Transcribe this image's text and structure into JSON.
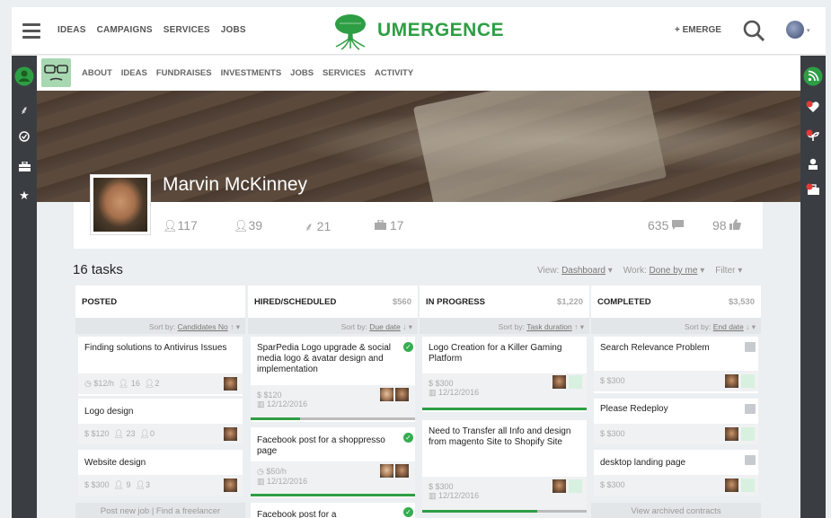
{
  "topnav": {
    "items": [
      "IDEAS",
      "CAMPAIGNS",
      "SERVICES",
      "JOBS"
    ],
    "brand": "UMERGENCE",
    "emerge_label": "+ EMERGE"
  },
  "profile_nav": {
    "items": [
      "ABOUT",
      "IDEAS",
      "FUNDRAISES",
      "INVESTMENTS",
      "JOBS",
      "SERVICES",
      "ACTIVITY"
    ]
  },
  "profile": {
    "name": "Marvin McKinney",
    "stats": {
      "a": "117",
      "b": "39",
      "c": "21",
      "d": "17",
      "comments": "635",
      "likes": "98"
    }
  },
  "tasks": {
    "title": "16 tasks",
    "view_label": "View:",
    "view_value": "Dashboard",
    "work_label": "Work:",
    "work_value": "Done by me",
    "filter_label": "Filter"
  },
  "columns": [
    {
      "title": "POSTED",
      "amount": "",
      "sort_label": "Sort by:",
      "sort_value": "Candidates No",
      "cards": [
        {
          "title": "Finding solutions to Antivirus Issues",
          "meta": "$12/h",
          "m2": "16",
          "m3": "2"
        },
        {
          "title": "Logo design",
          "meta": "$120",
          "m2": "23",
          "m3": "0"
        },
        {
          "title": "Website design",
          "meta": "$300",
          "m2": "9",
          "m3": "3"
        }
      ],
      "footer": "Post new job | Find a freelancer"
    },
    {
      "title": "HIRED/SCHEDULED",
      "amount": "$560",
      "sort_label": "Sort by:",
      "sort_value": "Due date",
      "cards": [
        {
          "title": "SparPedia Logo upgrade & social media logo & avatar design and implementation",
          "meta": "$120",
          "date": "12/12/2016",
          "progress": 0.3
        },
        {
          "title": "Facebook post for a shoppresso page",
          "meta": "$50/h",
          "date": "12/12/2016",
          "progress": 1.0
        },
        {
          "title": "Facebook post for a"
        }
      ]
    },
    {
      "title": "IN PROGRESS",
      "amount": "$1,220",
      "sort_label": "Sort by:",
      "sort_value": "Task duration",
      "cards": [
        {
          "title": "Logo Creation for a Killer Gaming Platform",
          "meta": "$300",
          "date": "12/12/2016",
          "progress": 1.0
        },
        {
          "title": "Need to Transfer all Info and design from magento Site to Shopify Site",
          "meta": "$300",
          "date": "12/12/2016",
          "progress": 0.7
        }
      ]
    },
    {
      "title": "COMPLETED",
      "amount": "$3,530",
      "sort_label": "Sort by:",
      "sort_value": "End date",
      "cards": [
        {
          "title": "Search Relevance Problem",
          "meta": "$300"
        },
        {
          "title": "Please Redeploy",
          "meta": "$300"
        },
        {
          "title": "desktop landing page",
          "meta": "$300"
        }
      ],
      "footer": "View archived contracts"
    }
  ]
}
